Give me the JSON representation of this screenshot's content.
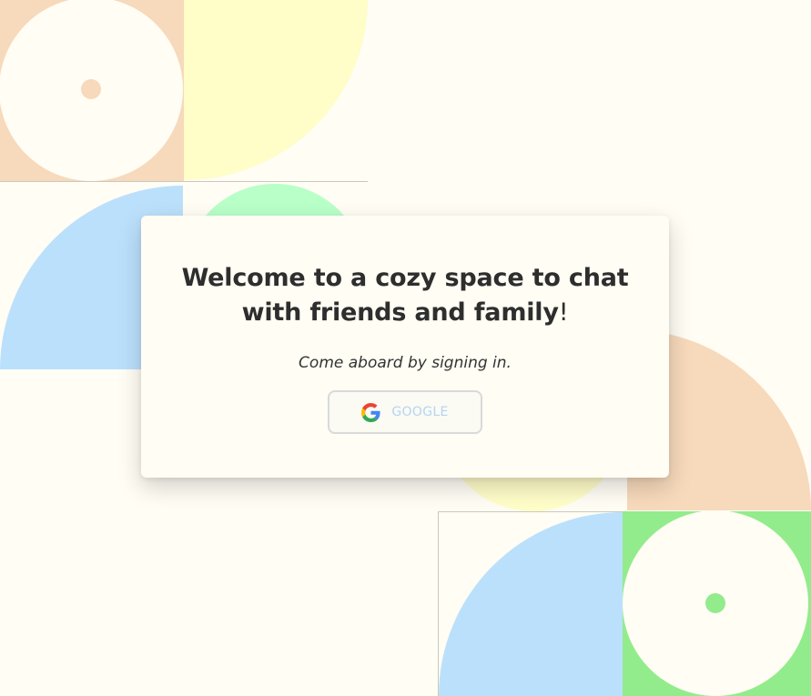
{
  "login": {
    "title_main": "Welcome to a cozy space to chat with friends and family",
    "title_end": "!",
    "subtitle": "Come aboard by signing in.",
    "google_button_label": "GOOGLE",
    "google_icon": "google-g-icon"
  },
  "colors": {
    "background": "#fffdf4",
    "peach": "#f7d9bb",
    "yellow": "#fffdc8",
    "light_blue": "#bbe0fc",
    "mint": "#b8ffc8",
    "green": "#92ec8c",
    "button_text": "#b3d6f3",
    "title_text": "#2e2e2e"
  }
}
